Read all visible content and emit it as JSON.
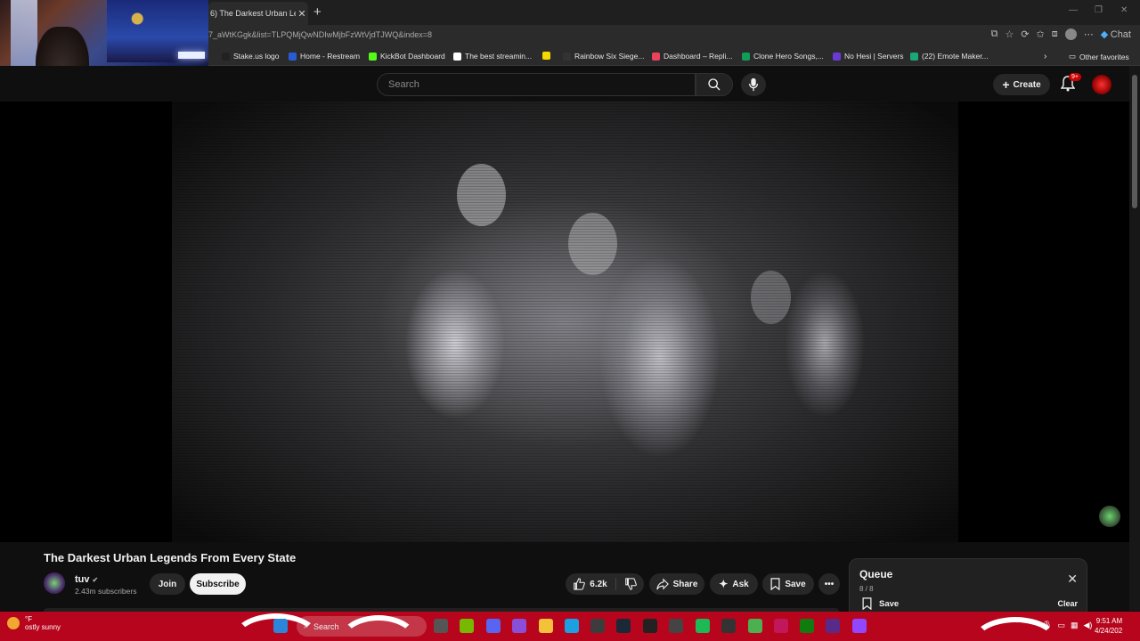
{
  "browser": {
    "tab_title": "(16) The Darkest Urban Legends From Every State",
    "tab_title_visible": "6) The Darkest Urban Lege",
    "url": "7_aWtKGgk&list=TLPQMjQwNDIwMjbFzWtVjdTJWQ&index=8",
    "chat_label": "Chat",
    "bookmarks": [
      {
        "label": "Stake.us logo",
        "color": "#222222"
      },
      {
        "label": "Home - Restream",
        "color": "#2a5bd7"
      },
      {
        "label": "KickBot Dashboard",
        "color": "#53fc18"
      },
      {
        "label": "The best streamin...",
        "color": "#ffffff"
      },
      {
        "label": "",
        "color": "#f5d800"
      },
      {
        "label": "Rainbow Six Siege...",
        "color": "#333333"
      },
      {
        "label": "Dashboard – Repli...",
        "color": "#e8435a"
      },
      {
        "label": "Clone Hero Songs,...",
        "color": "#0f9d58"
      },
      {
        "label": "No Hesi | Servers",
        "color": "#6a3ad6"
      },
      {
        "label": "(22) Emote Maker...",
        "color": "#1aa87a"
      }
    ],
    "other_favorites": "Other favorites"
  },
  "youtube": {
    "search_placeholder": "Search",
    "create_label": "Create",
    "notification_badge": "9+"
  },
  "video": {
    "title": "The Darkest Urban Legends From Every State",
    "channel": "tuv",
    "subscribers": "2.43m subscribers",
    "join_label": "Join",
    "subscribe_label": "Subscribe",
    "likes": "6.2k",
    "share_label": "Share",
    "ask_label": "Ask",
    "save_label": "Save"
  },
  "queue": {
    "title": "Queue",
    "count": "8 / 8",
    "save_label": "Save",
    "clear_label": "Clear"
  },
  "taskbar": {
    "weather_temp": "°F",
    "weather_desc": "ostly sunny",
    "search_label": "Search",
    "time": "9:51 AM",
    "date": "4/24/202"
  }
}
